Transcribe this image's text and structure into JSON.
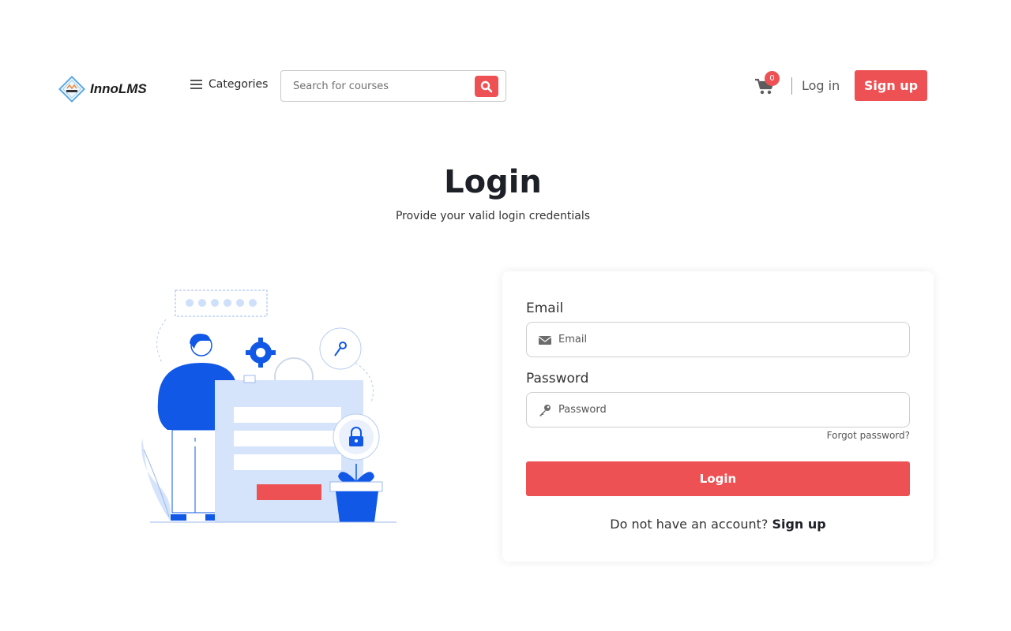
{
  "header": {
    "brand": "InnoLMS",
    "categories_label": "Categories",
    "search_placeholder": "Search for courses",
    "cart_count": "0",
    "login_label": "Log in",
    "signup_label": "Sign up"
  },
  "page": {
    "title": "Login",
    "subtitle": "Provide your valid login credentials"
  },
  "form": {
    "email_label": "Email",
    "email_placeholder": "Email",
    "password_label": "Password",
    "password_placeholder": "Password",
    "forgot_label": "Forgot password?",
    "submit_label": "Login",
    "no_account_text": "Do not have an account?",
    "signup_link": "Sign up"
  },
  "colors": {
    "accent": "#ed5153",
    "illustration_blue": "#1158e6",
    "illustration_light": "#d5e3fb"
  },
  "icons": [
    "logo-icon",
    "menu-icon",
    "search-icon",
    "cart-icon",
    "envelope-icon",
    "key-icon",
    "lock-icon",
    "gear-icon"
  ]
}
